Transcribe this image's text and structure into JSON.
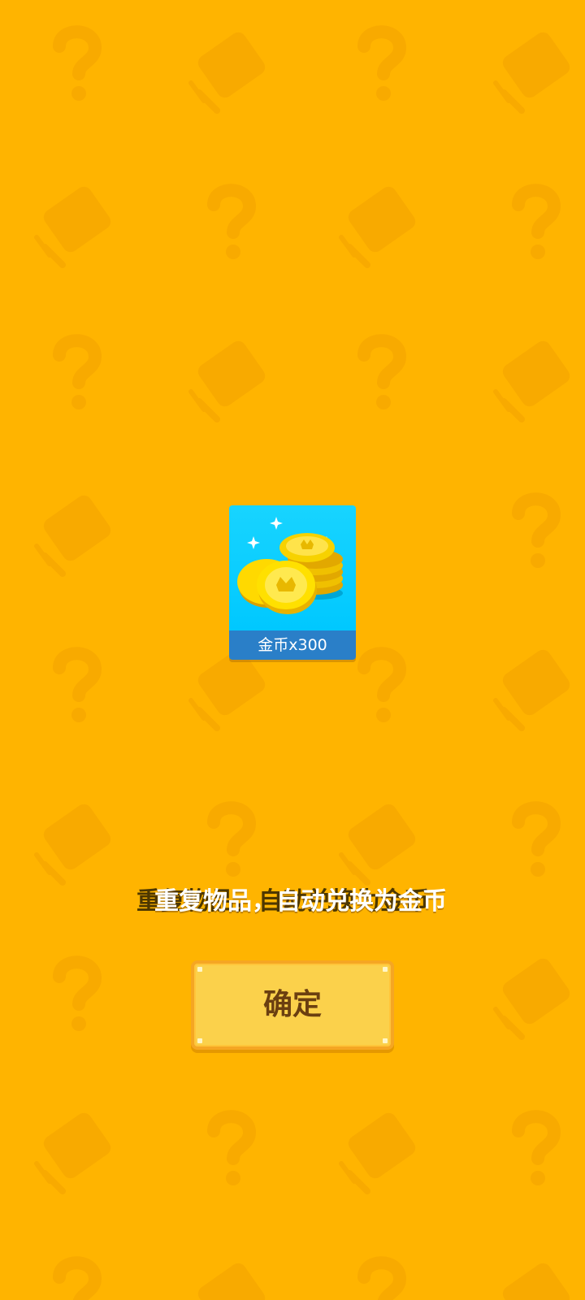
{
  "reward": {
    "caption": "金币x300",
    "icon": "gold-coins-icon"
  },
  "message": {
    "text": "重复物品，自动兑换为金币"
  },
  "confirm_button": {
    "label": "确定"
  },
  "colors": {
    "background": "#FFB400",
    "card_sky": "#00C8FF",
    "caption_bar": "#2A7FC8",
    "button_fill": "#FBD14B",
    "button_border": "#F5A623",
    "button_text": "#6B3F10"
  }
}
